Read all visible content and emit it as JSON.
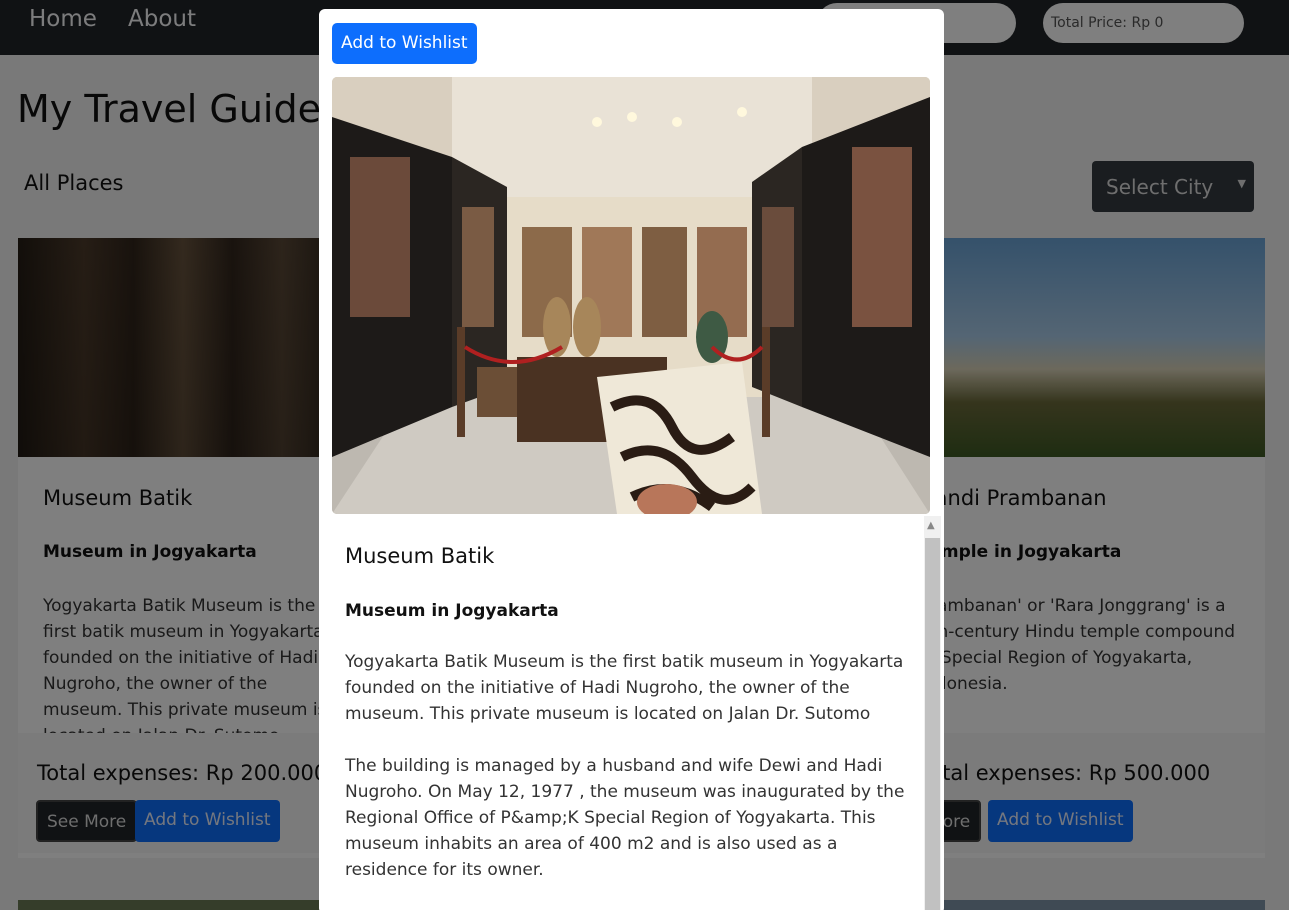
{
  "navbar": {
    "home": "Home",
    "about": "About",
    "search_placeholder": "",
    "total_price": "Total Price: Rp 0"
  },
  "page": {
    "title": "My Travel Guide",
    "section_title": "All Places",
    "city_select": "Select City"
  },
  "cards": [
    {
      "title": "Museum Batik",
      "subtitle": "Museum in Jogyakarta",
      "description": "Yogyakarta Batik Museum is the first batik museum in Yogyakarta founded on the initiative of Hadi Nugroho, the owner of the museum. This private museum is located on Jalan Dr. Sutomo",
      "expenses": "Total expenses: Rp 200.000",
      "see_more": "See More",
      "wishlist": "Add to Wishlist"
    },
    {
      "title": "Candi Prambanan",
      "subtitle": "Temple in Jogyakarta",
      "description": "Prambanan' or 'Rara Jonggrang' is a 9th-century Hindu temple compound in Special Region of Yogyakarta, Indonesia.",
      "expenses": "Total expenses: Rp 500.000",
      "see_more": "See More",
      "wishlist": "Add to Wishlist"
    }
  ],
  "modal": {
    "wishlist": "Add to Wishlist",
    "title": "Museum Batik",
    "subtitle": "Museum in Jogyakarta",
    "paragraph1": "Yogyakarta Batik Museum is the first batik museum in Yogyakarta founded on the initiative of Hadi Nugroho, the owner of the museum. This private museum is located on Jalan Dr. Sutomo",
    "paragraph2": "The building is managed by a husband and wife Dewi and Hadi Nugroho. On May 12, 1977 , the museum was inaugurated by the Regional Office of P&amp;K Special Region of Yogyakarta. This museum inhabits an area of 400 m2 and is also used as a residence for its owner."
  }
}
